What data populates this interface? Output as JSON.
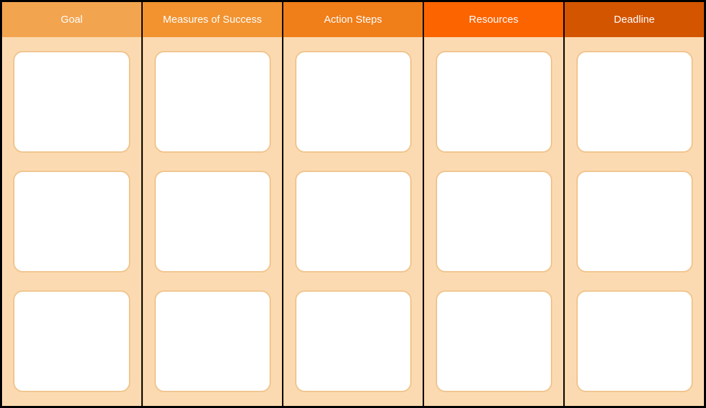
{
  "columns": [
    {
      "label": "Goal",
      "header_color": "#f3a44f"
    },
    {
      "label": "Measures of Success",
      "header_color": "#f29330"
    },
    {
      "label": "Action Steps",
      "header_color": "#f07e19"
    },
    {
      "label": "Resources",
      "header_color": "#fc6400"
    },
    {
      "label": "Deadline",
      "header_color": "#d45500"
    }
  ],
  "rows": 3,
  "card_background": "#ffffff",
  "body_background": "#fcdab1",
  "card_border": "#f0c58e"
}
